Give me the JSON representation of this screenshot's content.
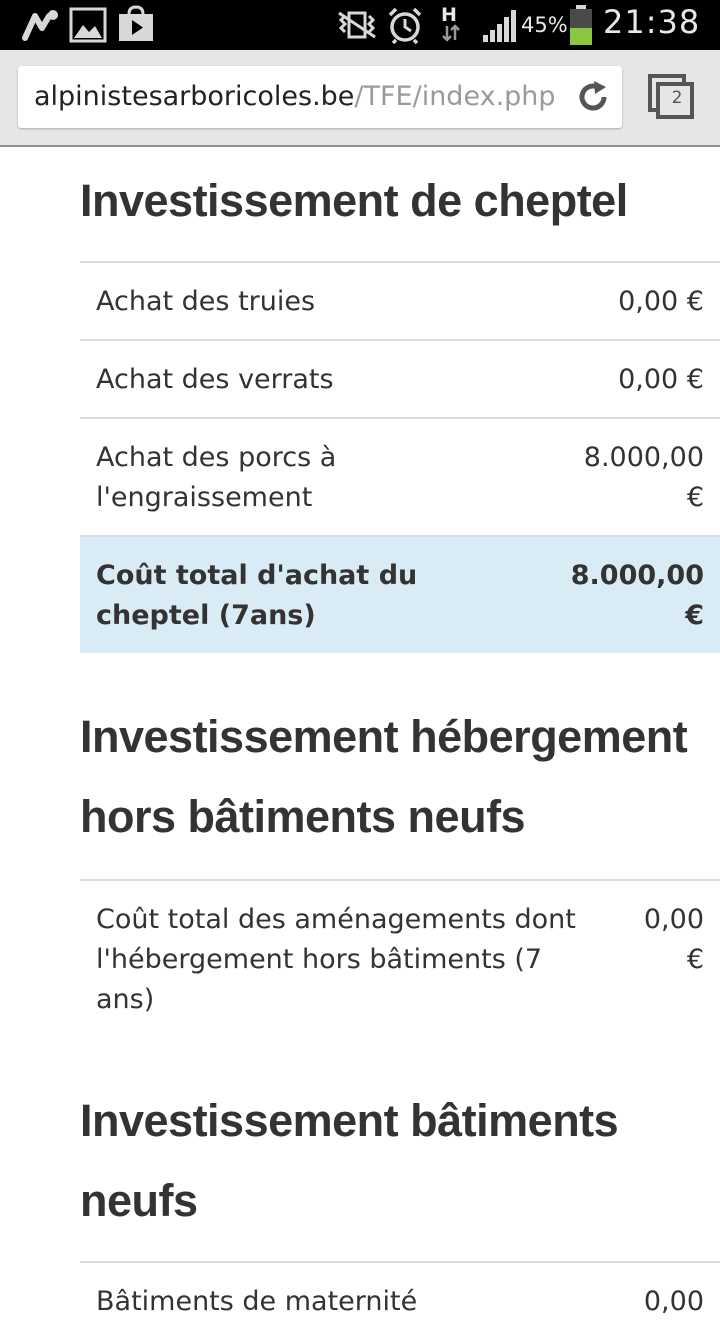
{
  "status_bar": {
    "battery_percent": "45%",
    "time": "21:38",
    "network_label": "H",
    "icons": [
      "notification-icon",
      "gallery-icon",
      "play-store-icon",
      "vibrate-icon",
      "alarm-icon",
      "data-transfer-icon",
      "signal-icon",
      "battery-icon"
    ]
  },
  "browser": {
    "url_domain": "alpinistesarboricoles.be",
    "url_path": "/TFE/index.php",
    "tab_count": "2",
    "icons": [
      "reload-icon",
      "tabs-icon"
    ]
  },
  "sections": [
    {
      "title": "Investissement de cheptel",
      "rows": [
        {
          "label": "Achat des truies",
          "amount": "0,00 €"
        },
        {
          "label": "Achat des verrats",
          "amount": "0,00 €"
        },
        {
          "label": "Achat des porcs à l'engraissement",
          "amount": "8.000,00 €"
        }
      ],
      "total": {
        "label": "Coût total d'achat du cheptel (7ans)",
        "amount": "8.000,00 €"
      }
    },
    {
      "title": "Investissement hébergement hors bâtiments neufs",
      "rows": [
        {
          "label": "Coût total des aménagements dont l'hébergement hors bâtiments (7 ans)",
          "amount": "0,00 €"
        }
      ]
    },
    {
      "title": "Investissement bâtiments neufs",
      "rows": [
        {
          "label": "Bâtiments de maternité",
          "amount": "0,00"
        }
      ]
    }
  ],
  "colors": {
    "status_bar_bg": "#000000",
    "chrome_bg": "#e6e6e6",
    "total_row_bg": "#d9ecf5",
    "battery_level": "#8cc63f"
  }
}
